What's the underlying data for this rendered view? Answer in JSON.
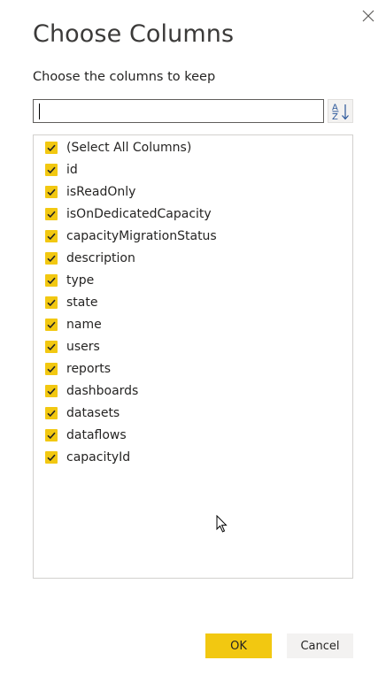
{
  "dialog": {
    "title": "Choose Columns",
    "subtitle": "Choose the columns to keep"
  },
  "search": {
    "value": "",
    "placeholder": ""
  },
  "sort_button": {
    "icon": "sort-az-icon"
  },
  "columns": [
    {
      "label": "(Select All Columns)",
      "checked": true
    },
    {
      "label": "id",
      "checked": true
    },
    {
      "label": "isReadOnly",
      "checked": true
    },
    {
      "label": "isOnDedicatedCapacity",
      "checked": true
    },
    {
      "label": "capacityMigrationStatus",
      "checked": true
    },
    {
      "label": "description",
      "checked": true
    },
    {
      "label": "type",
      "checked": true
    },
    {
      "label": "state",
      "checked": true
    },
    {
      "label": "name",
      "checked": true
    },
    {
      "label": "users",
      "checked": true
    },
    {
      "label": "reports",
      "checked": true
    },
    {
      "label": "dashboards",
      "checked": true
    },
    {
      "label": "datasets",
      "checked": true
    },
    {
      "label": "dataflows",
      "checked": true
    },
    {
      "label": "capacityId",
      "checked": true
    }
  ],
  "buttons": {
    "ok_label": "OK",
    "cancel_label": "Cancel"
  },
  "colors": {
    "accent": "#f2c811",
    "secondary_button": "#f3f2f1",
    "text": "#252423"
  }
}
